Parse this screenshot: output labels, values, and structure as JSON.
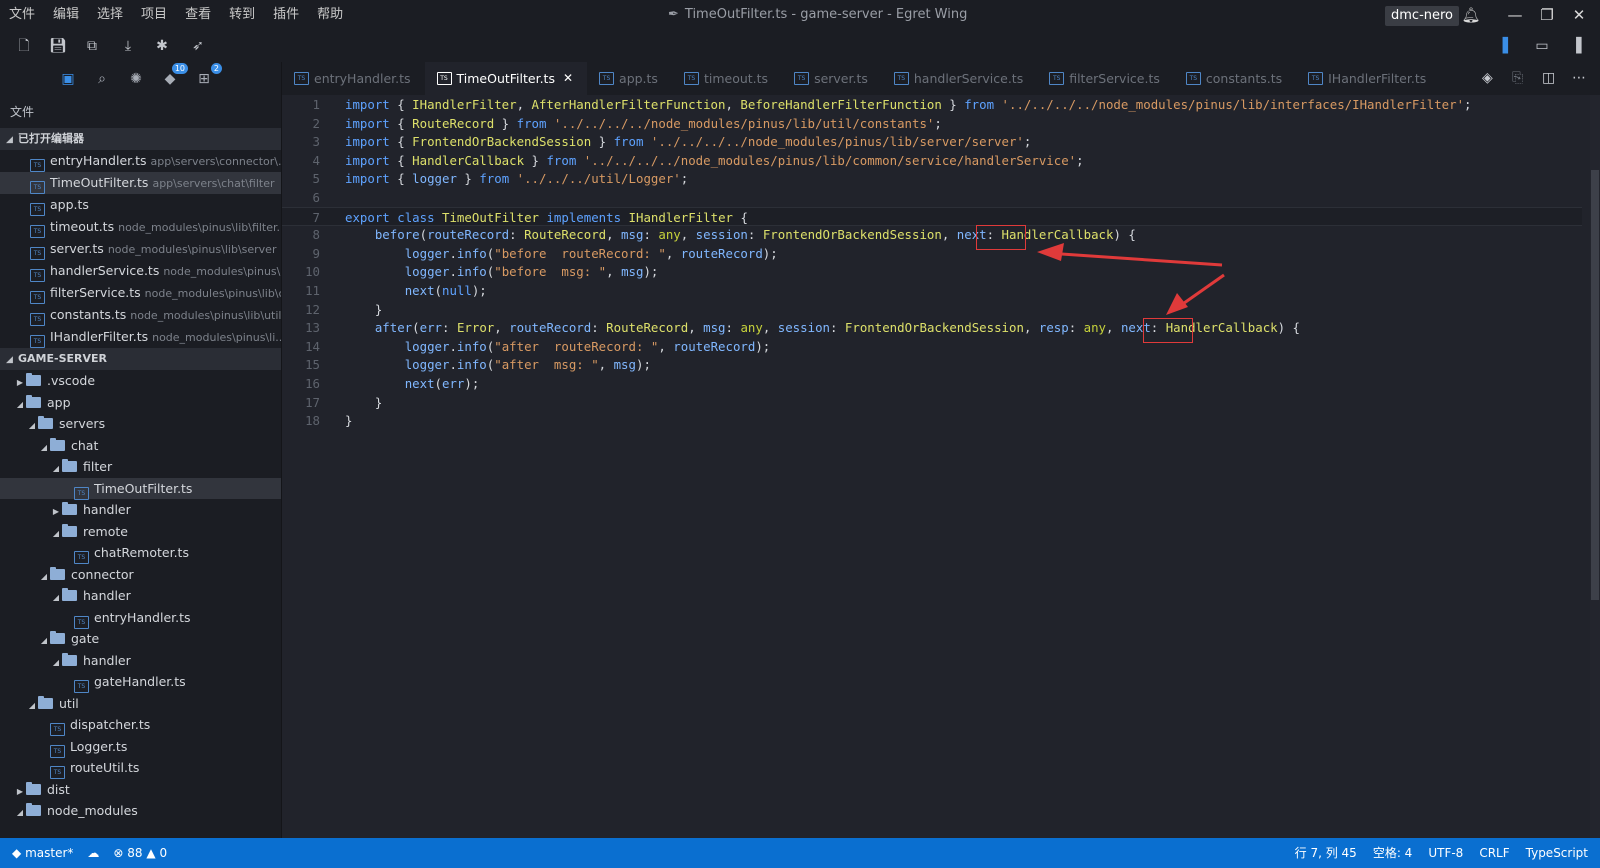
{
  "menu": [
    "文件",
    "编辑",
    "选择",
    "项目",
    "查看",
    "转到",
    "插件",
    "帮助"
  ],
  "window_title": "TimeOutFilter.ts - game-server - Egret Wing",
  "user": "dmc-nero",
  "sidebar": {
    "title": "文件",
    "badges": {
      "git": "10",
      "debug": "2"
    },
    "open_editors_header": "已打开编辑器",
    "open_editors": [
      {
        "name": "entryHandler.ts",
        "path": "app\\servers\\connector\\..."
      },
      {
        "name": "TimeOutFilter.ts",
        "path": "app\\servers\\chat\\filter"
      },
      {
        "name": "app.ts",
        "path": ""
      },
      {
        "name": "timeout.ts",
        "path": "node_modules\\pinus\\lib\\filter..."
      },
      {
        "name": "server.ts",
        "path": "node_modules\\pinus\\lib\\server"
      },
      {
        "name": "handlerService.ts",
        "path": "node_modules\\pinus\\l..."
      },
      {
        "name": "filterService.ts",
        "path": "node_modules\\pinus\\lib\\c..."
      },
      {
        "name": "constants.ts",
        "path": "node_modules\\pinus\\lib\\util"
      },
      {
        "name": "IHandlerFilter.ts",
        "path": "node_modules\\pinus\\li..."
      }
    ],
    "project_header": "GAME-SERVER",
    "tree": [
      {
        "label": ".vscode",
        "kind": "folder"
      },
      {
        "label": "app",
        "kind": "folder"
      },
      {
        "label": "servers",
        "kind": "folder"
      },
      {
        "label": "chat",
        "kind": "folder"
      },
      {
        "label": "filter",
        "kind": "folder"
      },
      {
        "label": "TimeOutFilter.ts",
        "kind": "file"
      },
      {
        "label": "handler",
        "kind": "folder"
      },
      {
        "label": "remote",
        "kind": "folder"
      },
      {
        "label": "chatRemoter.ts",
        "kind": "file"
      },
      {
        "label": "connector",
        "kind": "folder"
      },
      {
        "label": "handler",
        "kind": "folder"
      },
      {
        "label": "entryHandler.ts",
        "kind": "file"
      },
      {
        "label": "gate",
        "kind": "folder"
      },
      {
        "label": "handler",
        "kind": "folder"
      },
      {
        "label": "gateHandler.ts",
        "kind": "file"
      },
      {
        "label": "util",
        "kind": "folder"
      },
      {
        "label": "dispatcher.ts",
        "kind": "file"
      },
      {
        "label": "Logger.ts",
        "kind": "file"
      },
      {
        "label": "routeUtil.ts",
        "kind": "file"
      },
      {
        "label": "dist",
        "kind": "folder"
      },
      {
        "label": "node_modules",
        "kind": "folder"
      }
    ]
  },
  "tabs": [
    {
      "label": "entryHandler.ts",
      "active": false
    },
    {
      "label": "TimeOutFilter.ts",
      "active": true
    },
    {
      "label": "app.ts",
      "active": false
    },
    {
      "label": "timeout.ts",
      "active": false
    },
    {
      "label": "server.ts",
      "active": false
    },
    {
      "label": "handlerService.ts",
      "active": false
    },
    {
      "label": "filterService.ts",
      "active": false
    },
    {
      "label": "constants.ts",
      "active": false
    },
    {
      "label": "IHandlerFilter.ts",
      "active": false
    }
  ],
  "code_lines": [
    "import { IHandlerFilter, AfterHandlerFilterFunction, BeforeHandlerFilterFunction } from '../../../../node_modules/pinus/lib/interfaces/IHandlerFilter';",
    "import { RouteRecord } from '../../../../node_modules/pinus/lib/util/constants';",
    "import { FrontendOrBackendSession } from '../../../../node_modules/pinus/lib/server/server';",
    "import { HandlerCallback } from '../../../../node_modules/pinus/lib/common/service/handlerService';",
    "import { logger } from '../../../util/Logger';",
    "",
    "export class TimeOutFilter implements IHandlerFilter {",
    "    before(routeRecord: RouteRecord, msg: any, session: FrontendOrBackendSession, next: HandlerCallback) {",
    "        logger.info(\"before  routeRecord: \", routeRecord);",
    "        logger.info(\"before  msg: \", msg);",
    "        next(null);",
    "    }",
    "    after(err: Error, routeRecord: RouteRecord, msg: any, session: FrontendOrBackendSession, resp: any, next: HandlerCallback) {",
    "        logger.info(\"after  routeRecord: \", routeRecord);",
    "        logger.info(\"after  msg: \", msg);",
    "        next(err);",
    "    }",
    "}"
  ],
  "status": {
    "branch": "master*",
    "errors": "88",
    "warnings": "0",
    "position": "行 7, 列 45",
    "indent": "空格: 4",
    "encoding": "UTF-8",
    "eol": "CRLF",
    "language": "TypeScript"
  }
}
